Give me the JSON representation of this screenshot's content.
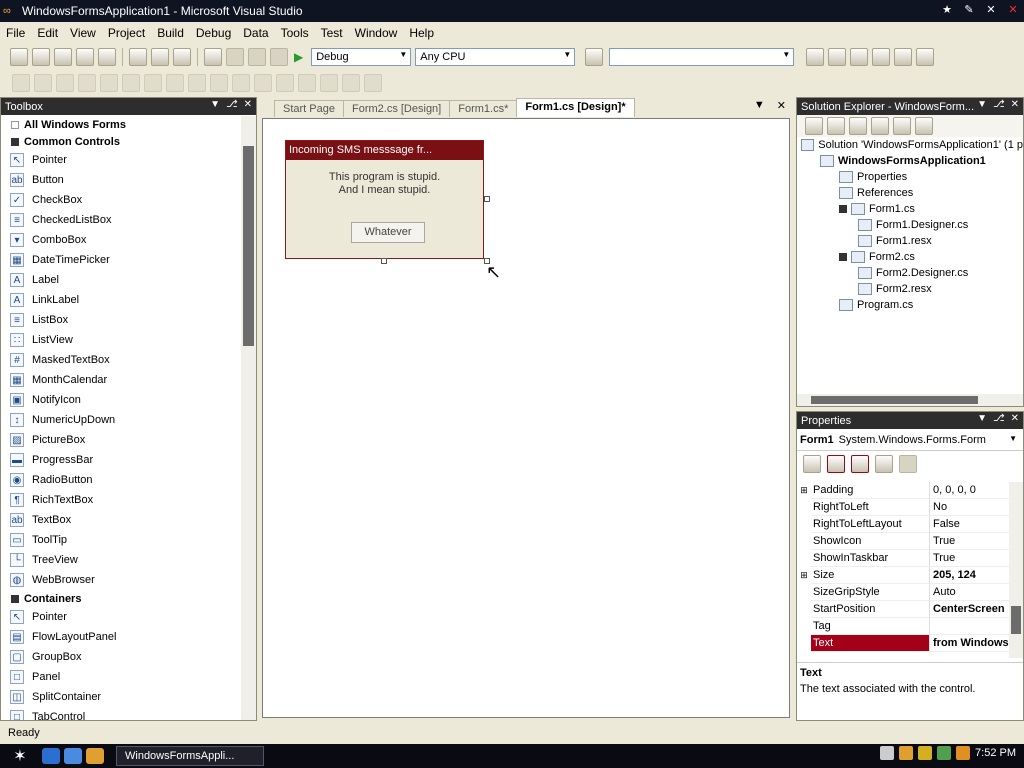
{
  "window": {
    "title": "WindowsFormsApplication1 - Microsoft Visual Studio",
    "buttons": [
      "★",
      "✎",
      "✕",
      "✕"
    ]
  },
  "menu": [
    "File",
    "Edit",
    "View",
    "Project",
    "Build",
    "Debug",
    "Data",
    "Tools",
    "Test",
    "Window",
    "Help"
  ],
  "toolbar": {
    "config": "Debug",
    "platform": "Any CPU"
  },
  "toolbox": {
    "title": "Toolbox",
    "all_label": "All Windows Forms",
    "common_label": "Common Controls",
    "common_items": [
      {
        "label": "Pointer",
        "icon": "pointer-icon",
        "glyph": "↖"
      },
      {
        "label": "Button",
        "icon": "button-icon",
        "glyph": "ab"
      },
      {
        "label": "CheckBox",
        "icon": "checkbox-icon",
        "glyph": "✓"
      },
      {
        "label": "CheckedListBox",
        "icon": "checkedlistbox-icon",
        "glyph": "≡"
      },
      {
        "label": "ComboBox",
        "icon": "combobox-icon",
        "glyph": "▾"
      },
      {
        "label": "DateTimePicker",
        "icon": "datetimepicker-icon",
        "glyph": "▦"
      },
      {
        "label": "Label",
        "icon": "label-icon",
        "glyph": "A"
      },
      {
        "label": "LinkLabel",
        "icon": "linklabel-icon",
        "glyph": "A"
      },
      {
        "label": "ListBox",
        "icon": "listbox-icon",
        "glyph": "≡"
      },
      {
        "label": "ListView",
        "icon": "listview-icon",
        "glyph": "∷"
      },
      {
        "label": "MaskedTextBox",
        "icon": "maskedtextbox-icon",
        "glyph": "#"
      },
      {
        "label": "MonthCalendar",
        "icon": "monthcalendar-icon",
        "glyph": "▦"
      },
      {
        "label": "NotifyIcon",
        "icon": "notifyicon-icon",
        "glyph": "▣"
      },
      {
        "label": "NumericUpDown",
        "icon": "numericupdown-icon",
        "glyph": "↕"
      },
      {
        "label": "PictureBox",
        "icon": "picturebox-icon",
        "glyph": "▨"
      },
      {
        "label": "ProgressBar",
        "icon": "progressbar-icon",
        "glyph": "▬"
      },
      {
        "label": "RadioButton",
        "icon": "radiobutton-icon",
        "glyph": "◉"
      },
      {
        "label": "RichTextBox",
        "icon": "richtextbox-icon",
        "glyph": "¶"
      },
      {
        "label": "TextBox",
        "icon": "textbox-icon",
        "glyph": "ab"
      },
      {
        "label": "ToolTip",
        "icon": "tooltip-icon",
        "glyph": "▭"
      },
      {
        "label": "TreeView",
        "icon": "treeview-icon",
        "glyph": "└"
      },
      {
        "label": "WebBrowser",
        "icon": "webbrowser-icon",
        "glyph": "◍"
      }
    ],
    "containers_label": "Containers",
    "container_items": [
      {
        "label": "Pointer",
        "icon": "pointer-icon",
        "glyph": "↖"
      },
      {
        "label": "FlowLayoutPanel",
        "icon": "flowlayoutpanel-icon",
        "glyph": "▤"
      },
      {
        "label": "GroupBox",
        "icon": "groupbox-icon",
        "glyph": "▢"
      },
      {
        "label": "Panel",
        "icon": "panel-icon",
        "glyph": "□"
      },
      {
        "label": "SplitContainer",
        "icon": "splitcontainer-icon",
        "glyph": "◫"
      },
      {
        "label": "TabControl",
        "icon": "tabcontrol-icon",
        "glyph": "□"
      }
    ]
  },
  "doc_tabs": [
    {
      "label": "Start Page",
      "active": false
    },
    {
      "label": "Form2.cs [Design]",
      "active": false
    },
    {
      "label": "Form1.cs*",
      "active": false
    },
    {
      "label": "Form1.cs [Design]*",
      "active": true
    }
  ],
  "form_preview": {
    "title": "Incoming SMS messsage fr...",
    "line1": "This program is stupid.",
    "line2": "And I mean stupid.",
    "button": "Whatever"
  },
  "solution_explorer": {
    "title": "Solution Explorer - WindowsForm...",
    "rows": [
      {
        "label": "Solution 'WindowsFormsApplication1' (1 p",
        "indent": 0,
        "bold": false,
        "icon": "solution-icon"
      },
      {
        "label": "WindowsFormsApplication1",
        "indent": 1,
        "bold": true,
        "icon": "csharp-project-icon"
      },
      {
        "label": "Properties",
        "indent": 2,
        "bold": false,
        "icon": "properties-folder-icon"
      },
      {
        "label": "References",
        "indent": 2,
        "bold": false,
        "icon": "references-folder-icon"
      },
      {
        "label": "Form1.cs",
        "indent": 2,
        "bold": false,
        "icon": "form-file-icon"
      },
      {
        "label": "Form1.Designer.cs",
        "indent": 3,
        "bold": false,
        "icon": "cs-file-icon"
      },
      {
        "label": "Form1.resx",
        "indent": 3,
        "bold": false,
        "icon": "resx-file-icon"
      },
      {
        "label": "Form2.cs",
        "indent": 2,
        "bold": false,
        "icon": "form-file-icon"
      },
      {
        "label": "Form2.Designer.cs",
        "indent": 3,
        "bold": false,
        "icon": "cs-file-icon"
      },
      {
        "label": "Form2.resx",
        "indent": 3,
        "bold": false,
        "icon": "resx-file-icon"
      },
      {
        "label": "Program.cs",
        "indent": 2,
        "bold": false,
        "icon": "cs-file-icon"
      }
    ]
  },
  "properties": {
    "title": "Properties",
    "object_name": "Form1",
    "object_type": "System.Windows.Forms.Form",
    "rows": [
      {
        "name": "Padding",
        "value": "0, 0, 0, 0",
        "expand": true,
        "bold": false,
        "selected": false
      },
      {
        "name": "RightToLeft",
        "value": "No",
        "expand": false,
        "bold": false,
        "selected": false
      },
      {
        "name": "RightToLeftLayout",
        "value": "False",
        "expand": false,
        "bold": false,
        "selected": false
      },
      {
        "name": "ShowIcon",
        "value": "True",
        "expand": false,
        "bold": false,
        "selected": false
      },
      {
        "name": "ShowInTaskbar",
        "value": "True",
        "expand": false,
        "bold": false,
        "selected": false
      },
      {
        "name": "Size",
        "value": "205, 124",
        "expand": true,
        "bold": true,
        "selected": false
      },
      {
        "name": "SizeGripStyle",
        "value": "Auto",
        "expand": false,
        "bold": false,
        "selected": false
      },
      {
        "name": "StartPosition",
        "value": "CenterScreen",
        "expand": false,
        "bold": true,
        "selected": false
      },
      {
        "name": "Tag",
        "value": "",
        "expand": false,
        "bold": false,
        "selected": false
      },
      {
        "name": "Text",
        "value": "from Windows",
        "expand": false,
        "bold": true,
        "selected": true
      }
    ],
    "desc_title": "Text",
    "desc_text": "The text associated with the control."
  },
  "status": "Ready",
  "taskbar": {
    "task_label": "WindowsFormsAppli...",
    "clock": "7:52 PM"
  }
}
